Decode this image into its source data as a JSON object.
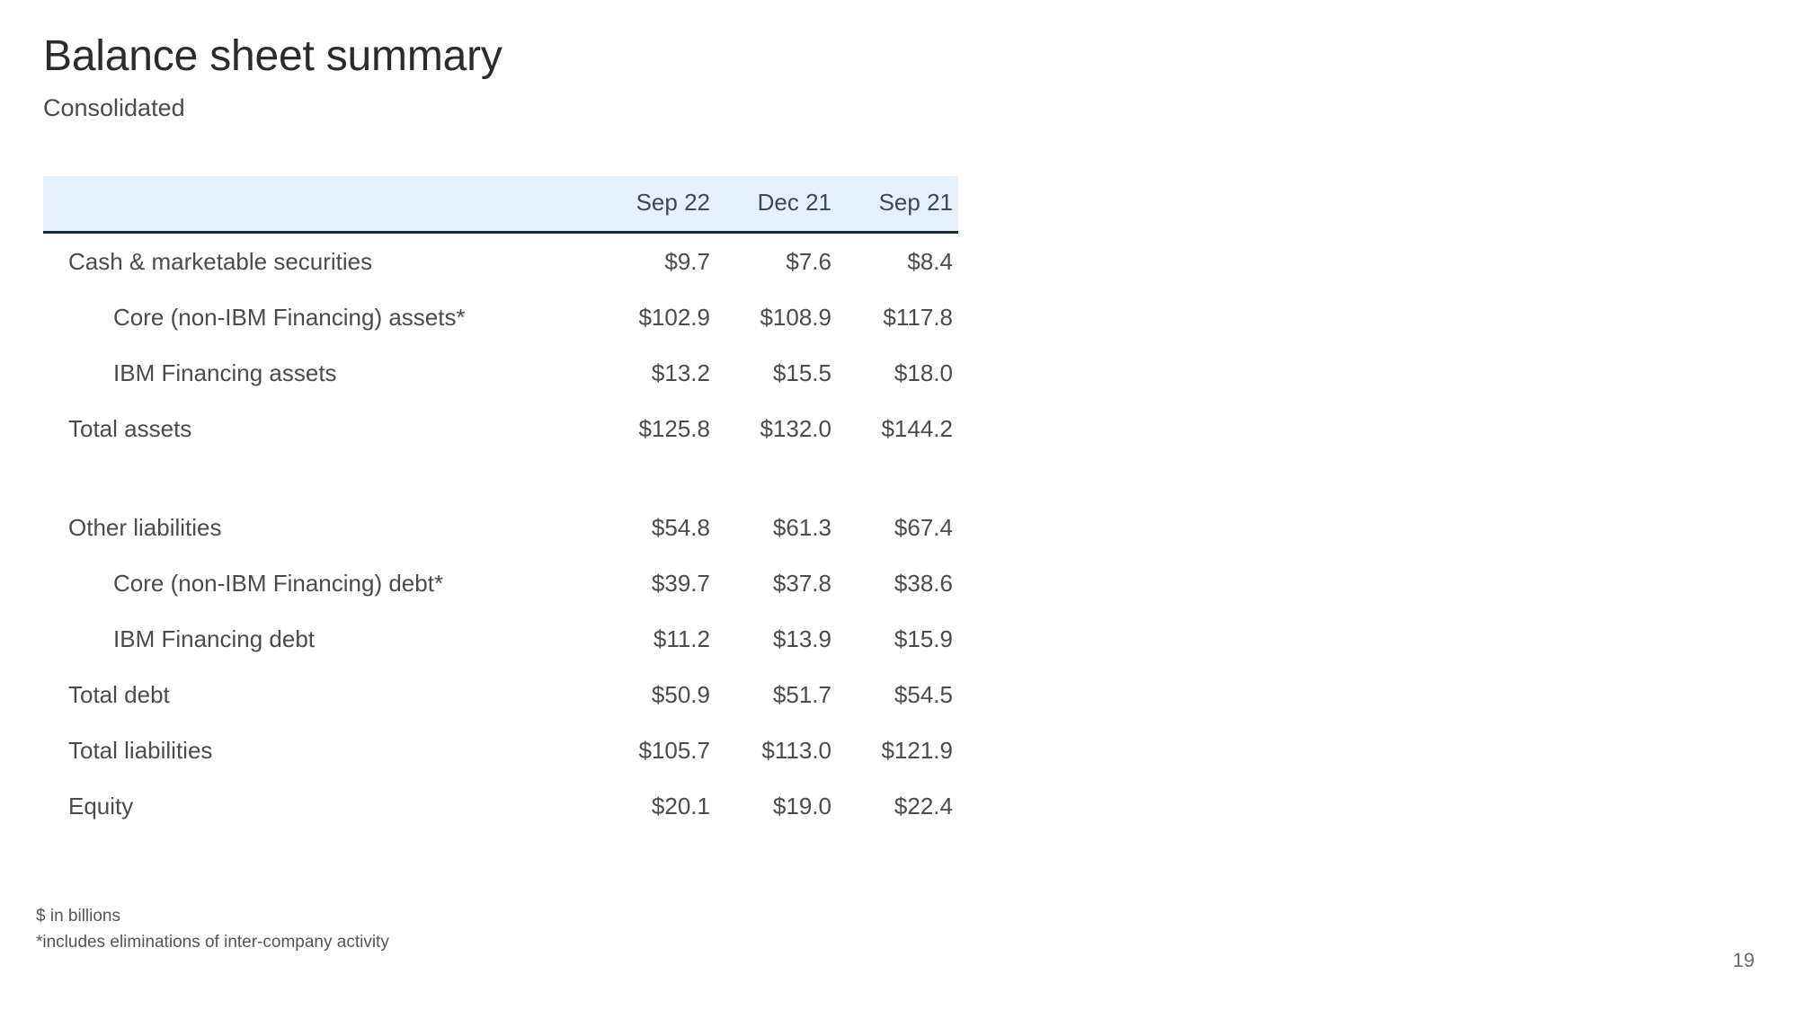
{
  "slide": {
    "title": "Balance sheet summary",
    "subtitle": "Consolidated",
    "page_number": "19",
    "header_bg_color": "#e5f1fa",
    "header_rule_color": "#1c2b33"
  },
  "table": {
    "label_column_header": "",
    "columns": [
      "Sep 22",
      "Dec 21",
      "Sep 21"
    ],
    "rows": [
      {
        "label": "Cash & marketable securities",
        "indent": 0,
        "values": [
          "$9.7",
          "$7.6",
          "$8.4"
        ]
      },
      {
        "label": "Core (non-IBM Financing) assets*",
        "indent": 1,
        "values": [
          "$102.9",
          "$108.9",
          "$117.8"
        ]
      },
      {
        "label": "IBM Financing assets",
        "indent": 1,
        "values": [
          "$13.2",
          "$15.5",
          "$18.0"
        ]
      },
      {
        "label": "Total assets",
        "indent": 0,
        "values": [
          "$125.8",
          "$132.0",
          "$144.2"
        ]
      },
      {
        "label": "",
        "indent": 0,
        "values": [
          "",
          "",
          ""
        ],
        "spacer": true
      },
      {
        "label": "Other liabilities",
        "indent": 0,
        "values": [
          "$54.8",
          "$61.3",
          "$67.4"
        ]
      },
      {
        "label": "Core (non-IBM Financing) debt*",
        "indent": 1,
        "values": [
          "$39.7",
          "$37.8",
          "$38.6"
        ]
      },
      {
        "label": "IBM Financing debt",
        "indent": 1,
        "values": [
          "$11.2",
          "$13.9",
          "$15.9"
        ]
      },
      {
        "label": "Total debt",
        "indent": 0,
        "values": [
          "$50.9",
          "$51.7",
          "$54.5"
        ]
      },
      {
        "label": "Total liabilities",
        "indent": 0,
        "values": [
          "$105.7",
          "$113.0",
          "$121.9"
        ]
      },
      {
        "label": "Equity",
        "indent": 0,
        "values": [
          "$20.1",
          "$19.0",
          "$22.4"
        ]
      }
    ]
  },
  "footnotes": [
    "$ in billions",
    "*includes eliminations of inter-company activity"
  ]
}
